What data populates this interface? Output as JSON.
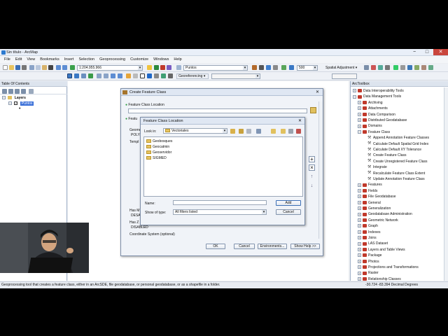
{
  "window": {
    "title": "Sin título - ArcMap",
    "min": "−",
    "max": "□",
    "close": "✕"
  },
  "menu": [
    "File",
    "Edit",
    "View",
    "Bookmarks",
    "Insert",
    "Selection",
    "Geoprocessing",
    "Customize",
    "Windows",
    "Help"
  ],
  "toolbar": {
    "scale": "1:204.955.966",
    "layer": "Puntos",
    "zoom": "500",
    "spatial_adjustment": "Spatial Adjustment ▾",
    "georeferencing": "Georeferencing ▾"
  },
  "toc": {
    "title": "Table Of Contents",
    "layers_label": "Layers",
    "layer_name": "Puntos",
    "symbol": "•"
  },
  "arctoolbox": {
    "title": "ArcToolbox",
    "items": [
      {
        "label": "Data Interoperability Tools",
        "kind": "toolbox",
        "exp": "+"
      },
      {
        "label": "Data Management Tools",
        "kind": "toolbox",
        "exp": "−"
      },
      {
        "label": "Archiving",
        "kind": "toolbox",
        "exp": "+"
      },
      {
        "label": "Attachments",
        "kind": "toolbox",
        "exp": "+"
      },
      {
        "label": "Data Comparison",
        "kind": "toolbox",
        "exp": "+"
      },
      {
        "label": "Distributed Geodatabase",
        "kind": "toolbox",
        "exp": "+"
      },
      {
        "label": "Domains",
        "kind": "toolbox",
        "exp": "+"
      },
      {
        "label": "Feature Class",
        "kind": "toolbox",
        "exp": "−"
      },
      {
        "label": "Append Annotation Feature Classes",
        "kind": "tool"
      },
      {
        "label": "Calculate Default Spatial Grid Index",
        "kind": "tool"
      },
      {
        "label": "Calculate Default XY Tolerance",
        "kind": "tool"
      },
      {
        "label": "Create Feature Class",
        "kind": "tool"
      },
      {
        "label": "Create Unregistered Feature Class",
        "kind": "tool"
      },
      {
        "label": "Integrate",
        "kind": "tool"
      },
      {
        "label": "Recalculate Feature Class Extent",
        "kind": "tool"
      },
      {
        "label": "Update Annotation Feature Class",
        "kind": "tool"
      },
      {
        "label": "Features",
        "kind": "toolbox",
        "exp": "+"
      },
      {
        "label": "Fields",
        "kind": "toolbox",
        "exp": "+"
      },
      {
        "label": "File Geodatabase",
        "kind": "toolbox",
        "exp": "+"
      },
      {
        "label": "General",
        "kind": "toolbox",
        "exp": "+"
      },
      {
        "label": "Generalization",
        "kind": "toolbox",
        "exp": "+"
      },
      {
        "label": "Geodatabase Administration",
        "kind": "toolbox",
        "exp": "+"
      },
      {
        "label": "Geometric Network",
        "kind": "toolbox",
        "exp": "+"
      },
      {
        "label": "Graph",
        "kind": "toolbox",
        "exp": "+"
      },
      {
        "label": "Indexes",
        "kind": "toolbox",
        "exp": "+"
      },
      {
        "label": "Joins",
        "kind": "toolbox",
        "exp": "+"
      },
      {
        "label": "LAS Dataset",
        "kind": "toolbox",
        "exp": "+"
      },
      {
        "label": "Layers and Table Views",
        "kind": "toolbox",
        "exp": "+"
      },
      {
        "label": "Package",
        "kind": "toolbox",
        "exp": "+"
      },
      {
        "label": "Photos",
        "kind": "toolbox",
        "exp": "+"
      },
      {
        "label": "Projections and Transformations",
        "kind": "toolbox",
        "exp": "+"
      },
      {
        "label": "Raster",
        "kind": "toolbox",
        "exp": "+"
      },
      {
        "label": "Relationship Classes",
        "kind": "toolbox",
        "exp": "+"
      }
    ]
  },
  "create_fc": {
    "title": "Create Feature Class",
    "location_label": "Feature Class Location",
    "name_label": "Featu",
    "geometry_label": "Geomet",
    "geometry_value": "POLY",
    "template_label": "Templ",
    "has_m_label": "Has M",
    "has_m_value": "DESA",
    "has_z_label": "Has Z",
    "has_z_value": "DISABLED",
    "coord_label": "Coordinate System (optional)",
    "ok": "OK",
    "cancel": "Cancel",
    "environments": "Environments...",
    "show_help": "Show Help >>"
  },
  "location_dialog": {
    "title": "Feature Class Location",
    "look_in_label": "Look in:",
    "look_in_value": "Vectoriales",
    "folders": [
      "Geobosques",
      "Geocatmin",
      "Geoservidor",
      "SIGMED"
    ],
    "name_label": "Name:",
    "name_value": "",
    "type_label": "Show of type:",
    "type_value": "All filters listed",
    "add": "Add",
    "cancel": "Cancel"
  },
  "status": {
    "message": "Geoprocessing tool that creates a feature class, either in an ArcSDE, file geodatabase, or personal geodatabase, or as a shapefile in a folder.",
    "coords": "-30.724  -83.394 Decimal Degrees"
  }
}
